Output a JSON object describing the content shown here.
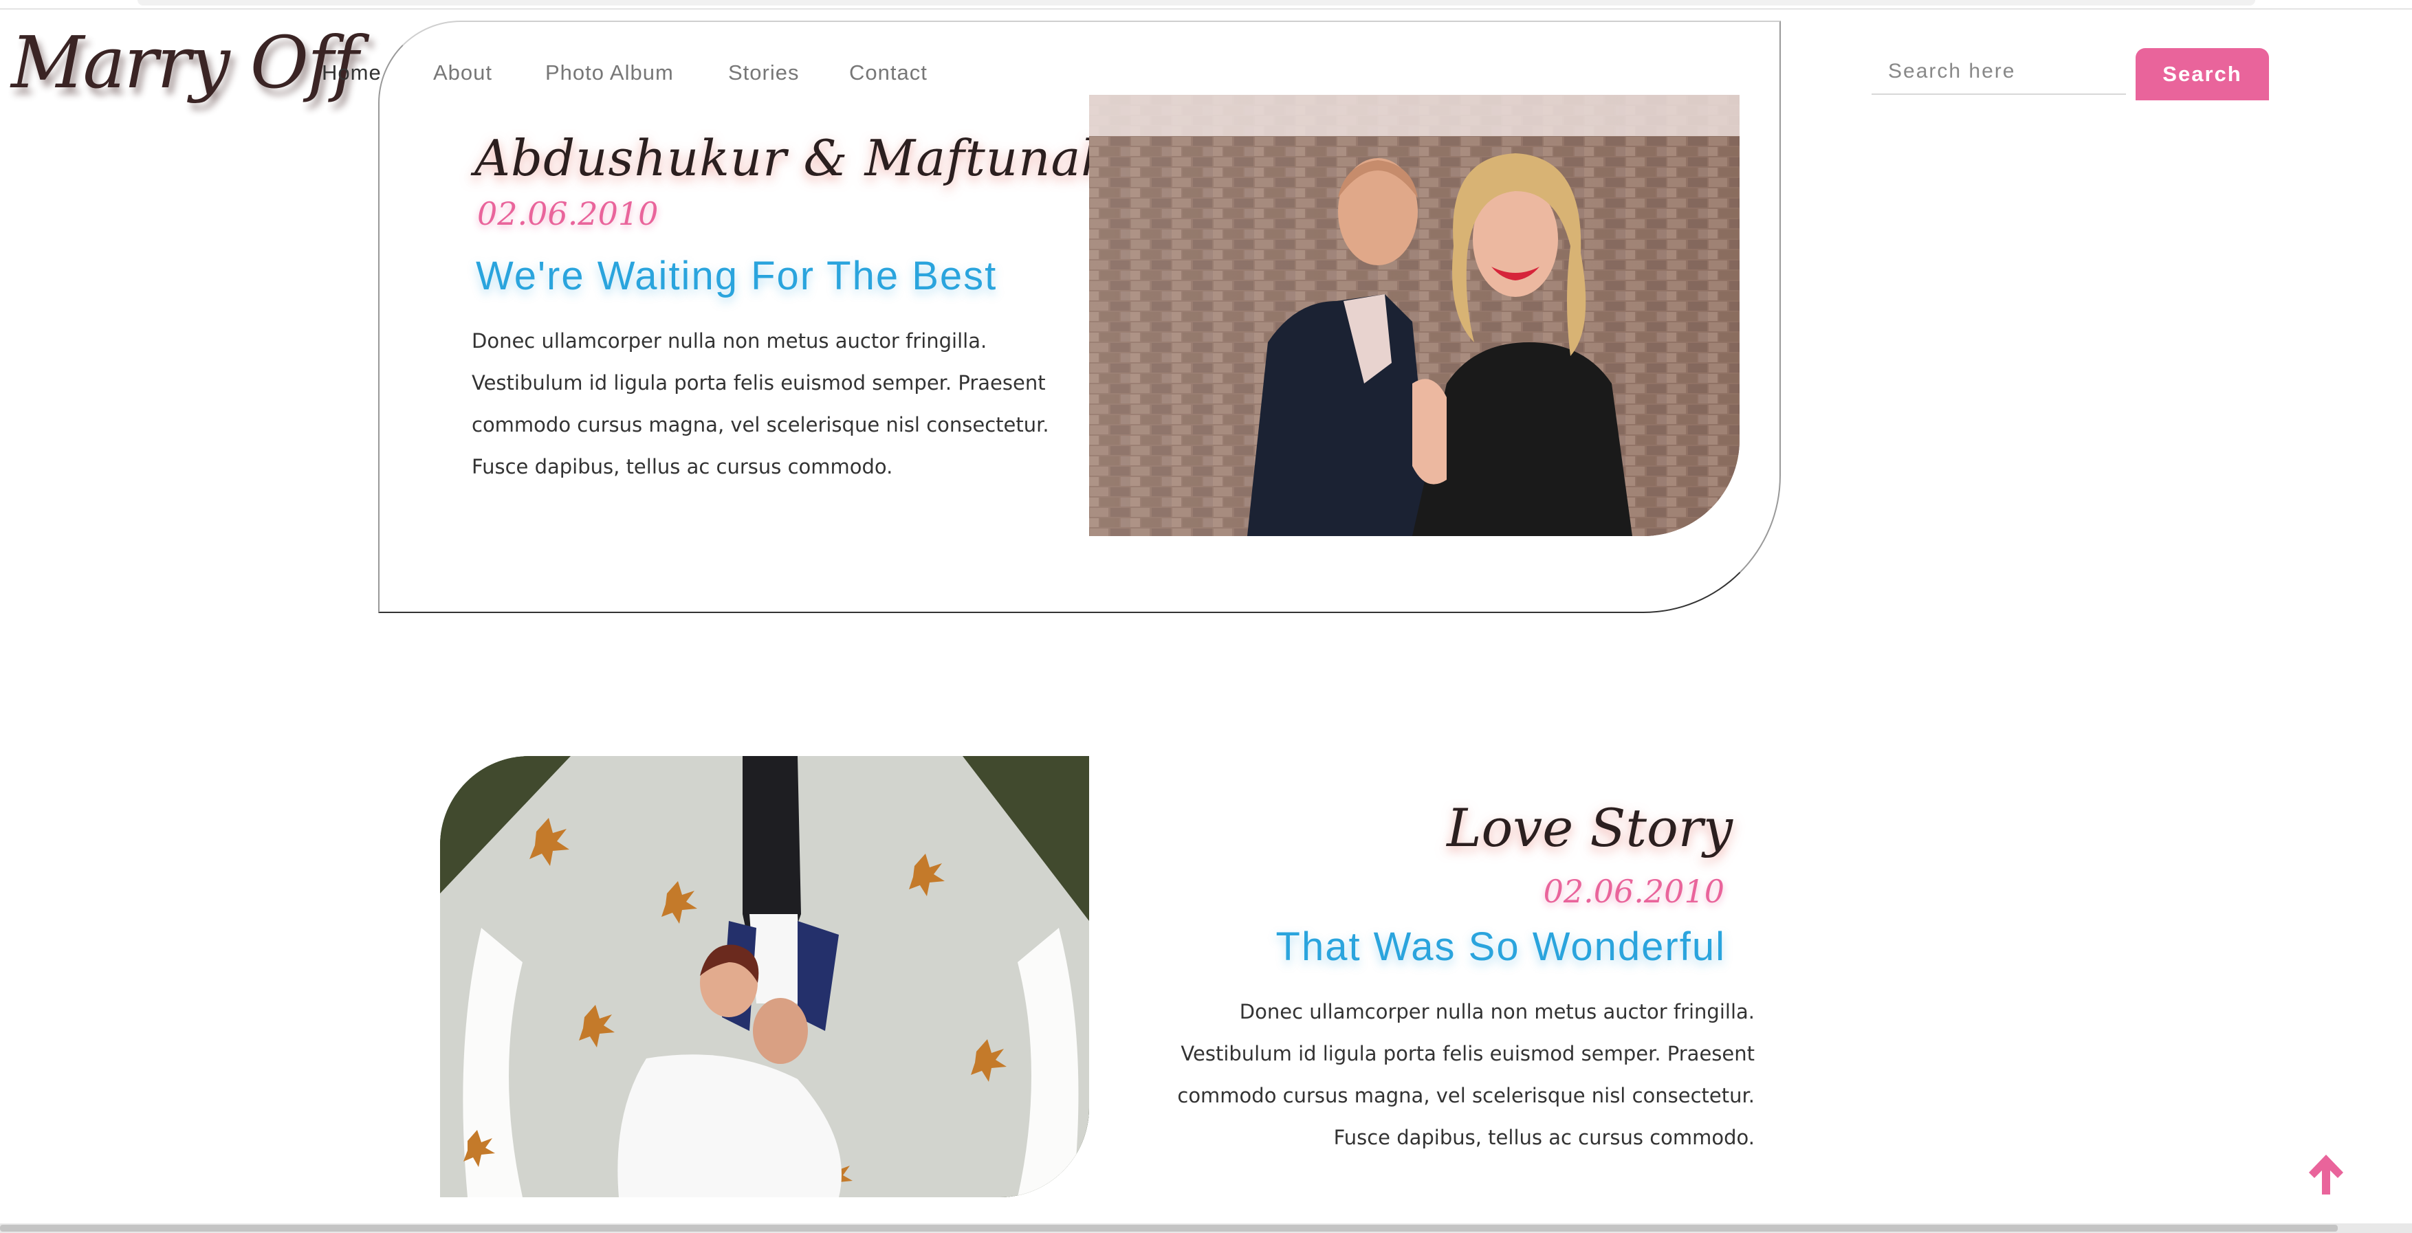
{
  "brand": {
    "logo": "Marry Off"
  },
  "nav": {
    "items": [
      {
        "label": "Home"
      },
      {
        "label": "About"
      },
      {
        "label": "Photo Album"
      },
      {
        "label": "Stories"
      },
      {
        "label": "Contact"
      }
    ]
  },
  "search": {
    "placeholder": "Search here",
    "button_label": "Search"
  },
  "hero": {
    "names": "Abdushukur & Maftunakhon",
    "date": "02.06.2010",
    "heading": "We're Waiting For The Best",
    "paragraph": "Donec ullamcorper nulla non metus auctor fringilla. Vestibulum id ligula porta felis euismod semper. Praesent commodo cursus magna, vel scelerisque nisl consectetur. Fusce dapibus, tellus ac cursus commodo."
  },
  "story": {
    "title": "Love Story",
    "date": "02.06.2010",
    "heading": "That Was So Wonderful",
    "paragraph": "Donec ullamcorper nulla non metus auctor fringilla. Vestibulum id ligula porta felis euismod semper. Praesent commodo cursus magna, vel scelerisque nisl consectetur. Fusce dapibus, tellus ac cursus commodo."
  },
  "colors": {
    "accent_pink": "#e9649b",
    "accent_blue": "#2aa4dd",
    "text_dark": "#2b1f1f"
  },
  "icons": {
    "scroll_top": "arrow-up-icon"
  }
}
